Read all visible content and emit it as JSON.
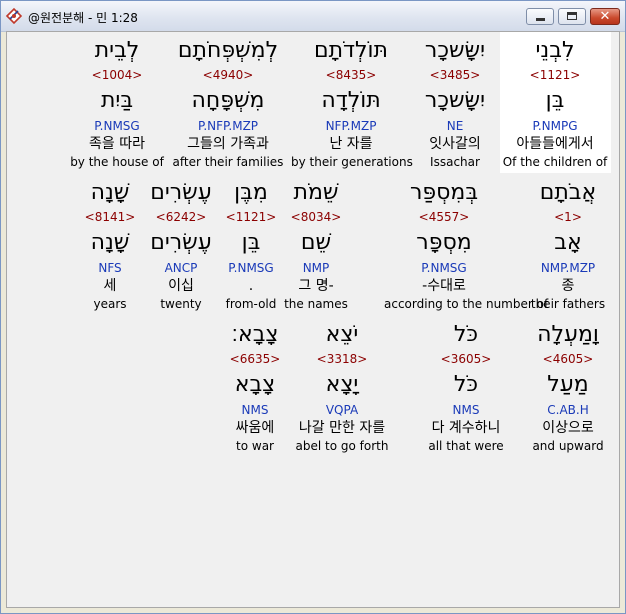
{
  "window": {
    "title": "@원전분해 - 민 1:28"
  },
  "rows": [
    [
      {
        "heb": "לִבְנֵי",
        "strong": "<1121>",
        "lemma": "בֵּן",
        "parse": "P.NMPG",
        "kor": "아들들에게서",
        "eng": "Of the children of",
        "highlight": true
      },
      {
        "heb": "יִשָּׂשכָר",
        "strong": "<3485>",
        "lemma": "יִשָּׂשכָר",
        "parse": "NE",
        "kor": "잇사갈의",
        "eng": "Issachar"
      },
      {
        "heb": "תּוֹלְדֹתָם",
        "strong": "<8435>",
        "lemma": "תּוֹלְדָה",
        "parse": "NFP.MZP",
        "kor": "난 자를",
        "eng": "by their generations"
      },
      {
        "heb": "לְמִשְׁפְּחֹתָם",
        "strong": "<4940>",
        "lemma": "מִשְׁפָּחָה",
        "parse": "P.NFP.MZP",
        "kor": "그들의 가족과",
        "eng": "after their families"
      },
      {
        "heb": "לְבֵית",
        "strong": "<1004>",
        "lemma": "בַּיִת",
        "parse": "P.NMSG",
        "kor": "족을 따라",
        "eng": "by the house of"
      }
    ],
    [
      {
        "heb": "אֲבֹתָם",
        "strong": "<1>",
        "lemma": "אָב",
        "parse": "NMP.MZP",
        "kor": "종",
        "eng": "their fathers"
      },
      {
        "heb": "בְּמִסְפַּר",
        "strong": "<4557>",
        "lemma": "מִסְפָּר",
        "parse": "P.NMSG",
        "kor": "-수대로",
        "eng": "according to the number of"
      },
      {
        "heb": "שֵׁמֹת",
        "strong": "<8034>",
        "lemma": "שֵׁם",
        "parse": "NMP",
        "kor": "그 명-",
        "eng": "the names"
      },
      {
        "heb": "מִבֶּן",
        "strong": "<1121>",
        "lemma": "בֵּן",
        "parse": "P.NMSG",
        "kor": ".",
        "eng": "from-old"
      },
      {
        "heb": "עֶשְׂרִים",
        "strong": "<6242>",
        "lemma": "עֶשְׂרִים",
        "parse": "ANCP",
        "kor": "이십",
        "eng": "twenty"
      },
      {
        "heb": "שָׁנָה",
        "strong": "<8141>",
        "lemma": "שָׁנָה",
        "parse": "NFS",
        "kor": "세",
        "eng": "years"
      }
    ],
    [
      {
        "heb": "וָמַעְלָה",
        "strong": "<4605>",
        "lemma": "מַעַל",
        "parse": "C.AB.H",
        "kor": "이상으로",
        "eng": "and upward"
      },
      {
        "heb": "כֹּל",
        "strong": "<3605>",
        "lemma": "כֹּל",
        "parse": "NMS",
        "kor": "다 계수하니",
        "eng": "all that were"
      },
      {
        "heb": "יֹצֵא",
        "strong": "<3318>",
        "lemma": "יָצָא",
        "parse": "VQPA",
        "kor": "나갈 만한 자를",
        "eng": "abel to go forth"
      },
      {
        "heb": "צָבָא׃",
        "strong": "<6635>",
        "lemma": "צָבָא",
        "parse": "NMS",
        "kor": "싸움에",
        "eng": "to war"
      }
    ]
  ]
}
